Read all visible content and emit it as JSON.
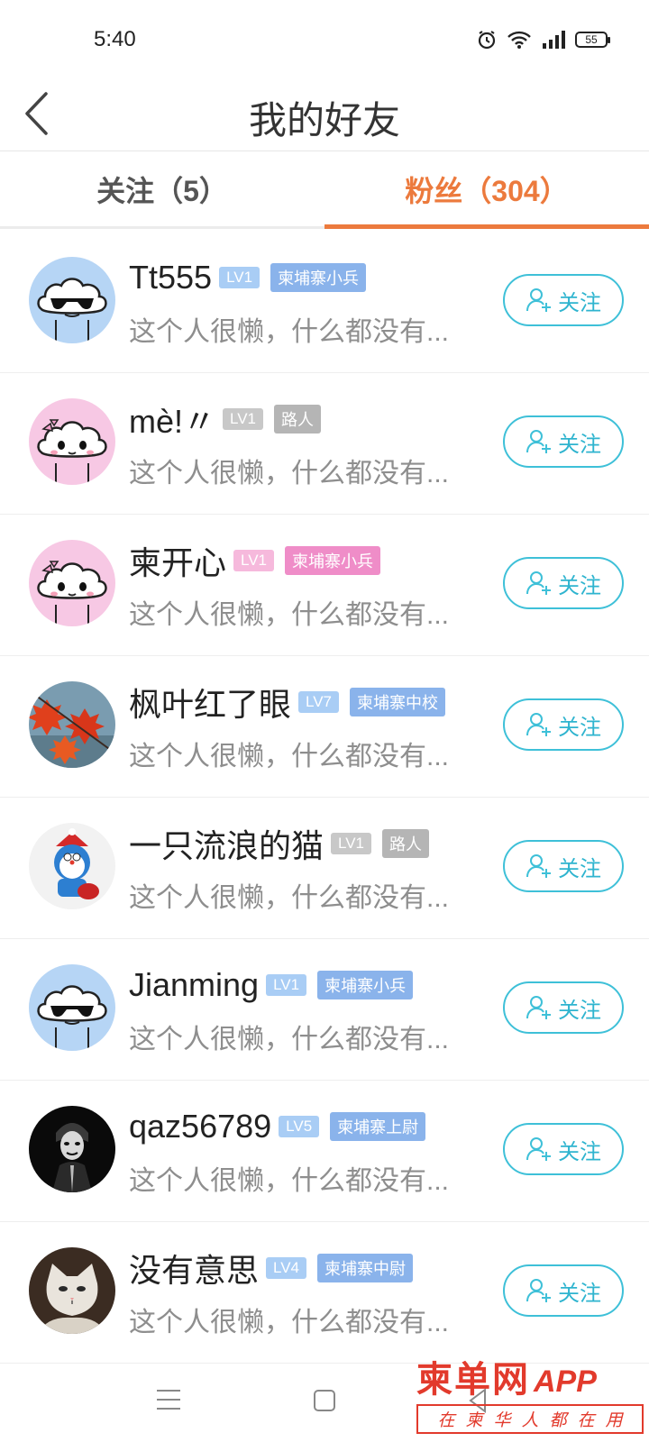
{
  "status_bar": {
    "time": "5:40",
    "battery": "55"
  },
  "header": {
    "title": "我的好友"
  },
  "tabs": {
    "follow": "关注（5）",
    "fans": "粉丝（304）"
  },
  "follow_label": "关注",
  "colors": {
    "accent_orange": "#ec7a3d",
    "follow_cyan": "#3ec0d8",
    "lv_blue": "#a9cdf5",
    "rank_blue": "#8ab3eb",
    "lv_gray": "#c8c8c8",
    "rank_gray": "#b5b5b5",
    "lv_pink": "#f6b9dc",
    "rank_pink": "#ef8dc8"
  },
  "users": [
    {
      "name": "Tt555",
      "level": "LV1",
      "rank": "柬埔寨小兵",
      "bio": "这个人很懒，什么都没有...",
      "avatar": "cloud-sunglasses-icon"
    },
    {
      "name": "mè!〃",
      "level": "LV1",
      "rank": "路人",
      "bio": "这个人很懒，什么都没有...",
      "avatar": "cloud-girl-icon"
    },
    {
      "name": "柬开心",
      "level": "LV1",
      "rank": "柬埔寨小兵",
      "bio": "这个人很懒，什么都没有...",
      "avatar": "cloud-girl-icon"
    },
    {
      "name": "枫叶红了眼",
      "level": "LV7",
      "rank": "柬埔寨中校",
      "bio": "这个人很懒，什么都没有...",
      "avatar": "maple-leaves-photo"
    },
    {
      "name": "一只流浪的猫",
      "level": "LV1",
      "rank": "路人",
      "bio": "这个人很懒，什么都没有...",
      "avatar": "doraemon-photo"
    },
    {
      "name": "Jianming",
      "level": "LV1",
      "rank": "柬埔寨小兵",
      "bio": "这个人很懒，什么都没有...",
      "avatar": "cloud-sunglasses-icon"
    },
    {
      "name": "qaz56789",
      "level": "LV5",
      "rank": "柬埔寨上尉",
      "bio": "这个人很懒，什么都没有...",
      "avatar": "joker-photo"
    },
    {
      "name": "没有意思",
      "level": "LV4",
      "rank": "柬埔寨中尉",
      "bio": "这个人很懒，什么都没有...",
      "avatar": "cat-photo"
    }
  ],
  "watermark": {
    "main": "柬单网",
    "app": "APP",
    "slogan": "在柬华人都在用"
  }
}
